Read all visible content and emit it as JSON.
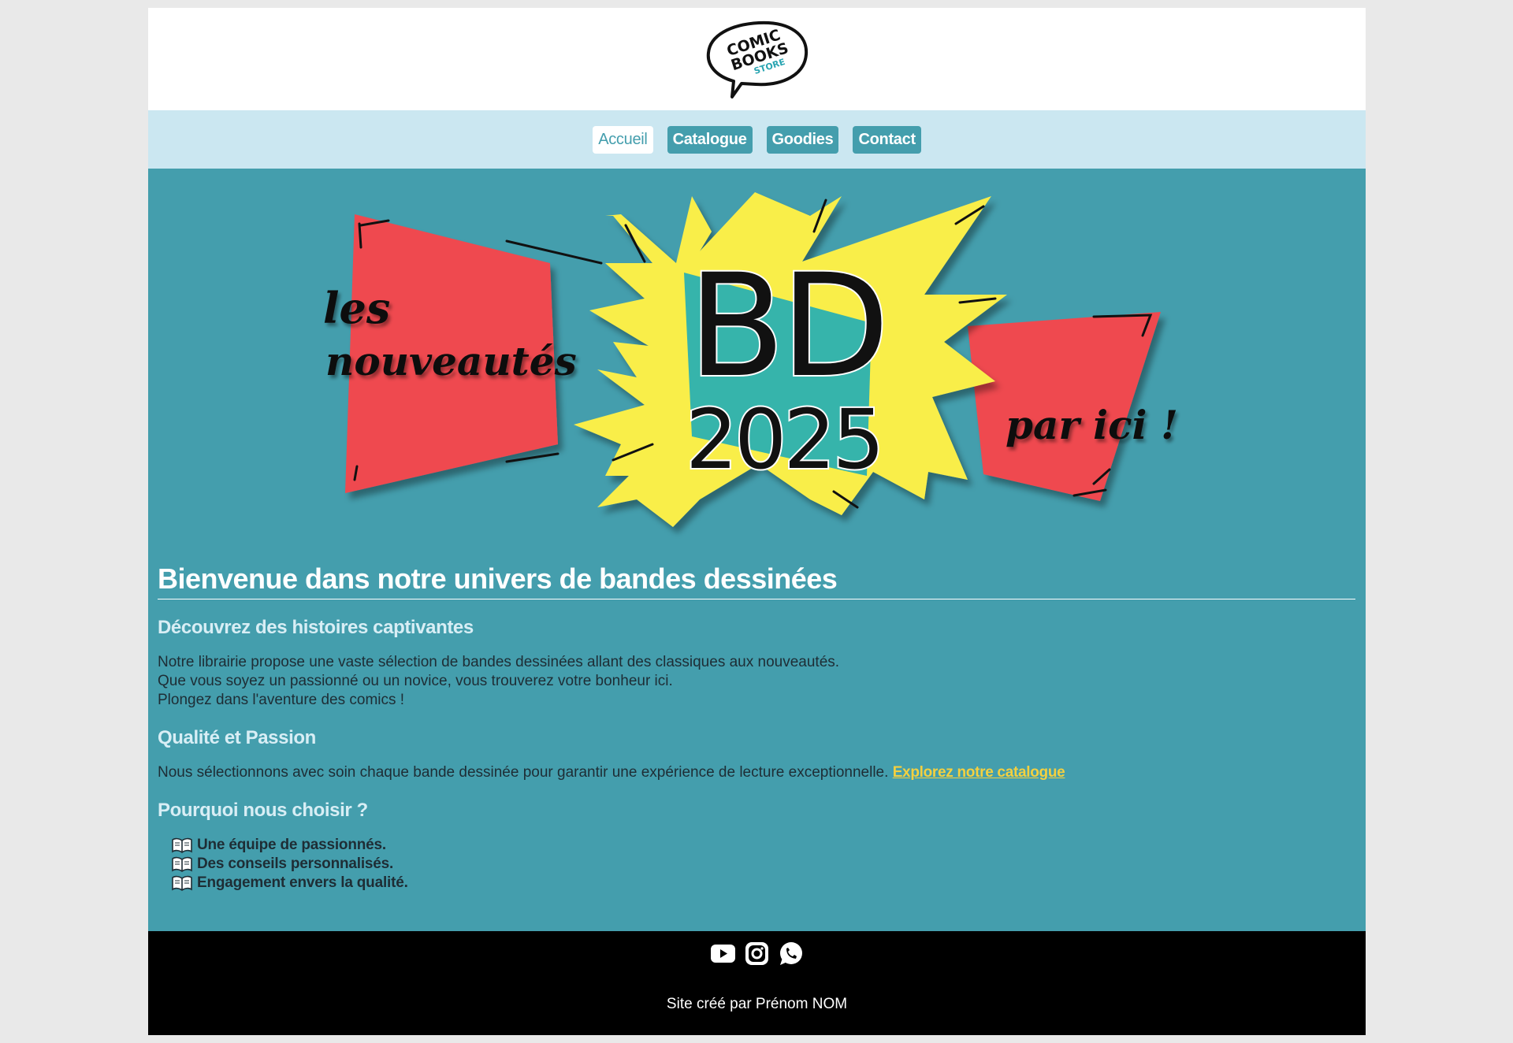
{
  "header": {
    "logo_lines": [
      "COMIC",
      "BOOKS",
      "STORE"
    ]
  },
  "nav": {
    "items": [
      {
        "label": "Accueil",
        "active": true
      },
      {
        "label": "Catalogue",
        "active": false
      },
      {
        "label": "Goodies",
        "active": false
      },
      {
        "label": "Contact",
        "active": false
      }
    ]
  },
  "banner": {
    "left_line1": "les",
    "left_line2": "nouveautés",
    "center_line1": "BD",
    "center_line2": "2025",
    "right_text": "par ici !"
  },
  "main": {
    "title": "Bienvenue dans notre univers de bandes dessinées",
    "section1": {
      "heading": "Découvrez des histoires captivantes",
      "lines": [
        "Notre librairie propose une vaste sélection de bandes dessinées allant des classiques aux nouveautés.",
        "Que vous soyez un passionné ou un novice, vous trouverez votre bonheur ici.",
        "Plongez dans l'aventure des comics !"
      ]
    },
    "section2": {
      "heading": "Qualité et Passion",
      "text": "Nous sélectionnons avec soin chaque bande dessinée pour garantir une expérience de lecture exceptionnelle.",
      "link": "Explorez notre catalogue"
    },
    "section3": {
      "heading": "Pourquoi nous choisir ?",
      "items": [
        "Une équipe de passionnés.",
        "Des conseils personnalisés.",
        "Engagement envers la qualité."
      ],
      "item_icon": "open-book-icon"
    }
  },
  "footer": {
    "social_icons": [
      "youtube-icon",
      "instagram-icon",
      "whatsapp-icon"
    ],
    "credit": "Site créé par Prénom NOM"
  },
  "colors": {
    "teal": "#449ead",
    "nav_bg": "#cbe7f1",
    "red": "#ef4950",
    "yellow": "#f9ee4a",
    "link": "#f4d03f",
    "footer_bg": "#000000"
  }
}
